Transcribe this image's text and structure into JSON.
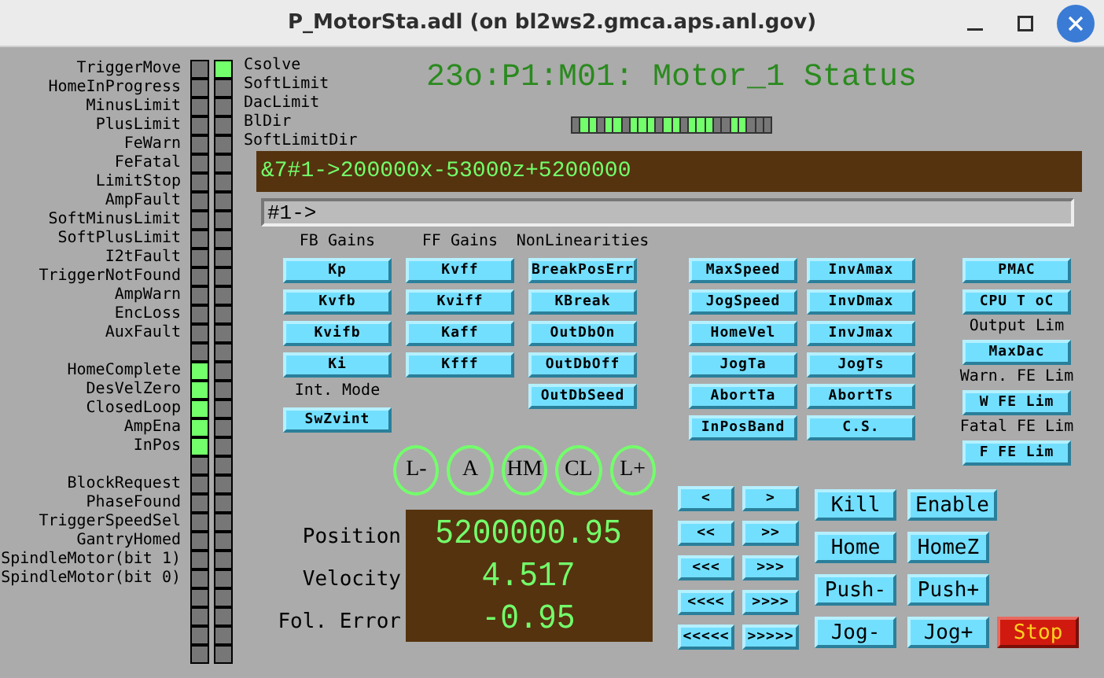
{
  "window": {
    "title": "P_MotorSta.adl (on bl2ws2.gmca.aps.anl.gov)"
  },
  "status_bits_left": [
    {
      "label": "TriggerMove",
      "on": false
    },
    {
      "label": "HomeInProgress",
      "on": false
    },
    {
      "label": "MinusLimit",
      "on": false
    },
    {
      "label": "PlusLimit",
      "on": false
    },
    {
      "label": "FeWarn",
      "on": false
    },
    {
      "label": "FeFatal",
      "on": false
    },
    {
      "label": "LimitStop",
      "on": false
    },
    {
      "label": "AmpFault",
      "on": false
    },
    {
      "label": "SoftMinusLimit",
      "on": false
    },
    {
      "label": "SoftPlusLimit",
      "on": false
    },
    {
      "label": "I2tFault",
      "on": false
    },
    {
      "label": "TriggerNotFound",
      "on": false
    },
    {
      "label": "AmpWarn",
      "on": false
    },
    {
      "label": "EncLoss",
      "on": false
    },
    {
      "label": "AuxFault",
      "on": false
    },
    {
      "on": false
    },
    {
      "label": "HomeComplete",
      "on": true
    },
    {
      "label": "DesVelZero",
      "on": true
    },
    {
      "label": "ClosedLoop",
      "on": true
    },
    {
      "label": "AmpEna",
      "on": true
    },
    {
      "label": "InPos",
      "on": true
    },
    {
      "on": false
    },
    {
      "label": "BlockRequest",
      "on": false
    },
    {
      "label": "PhaseFound",
      "on": false
    },
    {
      "label": "TriggerSpeedSel",
      "on": false
    },
    {
      "label": "GantryHomed",
      "on": false
    },
    {
      "label": "SpindleMotor(bit 1)",
      "on": false
    },
    {
      "label": "SpindleMotor(bit 0)",
      "on": false
    },
    {
      "on": false
    },
    {
      "on": false
    },
    {
      "on": false
    },
    {
      "on": false
    }
  ],
  "status_bits_right": [
    {
      "label": "Csolve",
      "on": true
    },
    {
      "label": "SoftLimit",
      "on": false
    },
    {
      "label": "DacLimit",
      "on": false
    },
    {
      "label": "BlDir",
      "on": false
    },
    {
      "label": "SoftLimitDir",
      "on": false
    },
    {
      "on": false
    },
    {
      "on": false
    },
    {
      "on": false
    },
    {
      "on": false
    },
    {
      "on": false
    },
    {
      "on": false
    },
    {
      "on": false
    },
    {
      "on": false
    },
    {
      "on": false
    },
    {
      "on": false
    },
    {
      "on": false
    },
    {
      "on": false
    },
    {
      "on": false
    },
    {
      "on": false
    },
    {
      "on": false
    },
    {
      "on": false
    },
    {
      "on": false
    },
    {
      "on": false
    },
    {
      "on": false
    },
    {
      "on": false
    },
    {
      "on": false
    },
    {
      "on": false
    },
    {
      "on": false
    },
    {
      "on": false
    },
    {
      "on": false
    },
    {
      "on": false
    },
    {
      "on": false
    }
  ],
  "title": "23o:P1:M01: Motor_1 Status",
  "activity_bits": [
    {
      "on": false
    },
    {
      "on": true
    },
    {
      "on": true
    },
    {
      "on": false
    },
    {
      "on": true
    },
    {
      "on": true
    },
    {
      "on": false
    },
    {
      "on": true
    },
    {
      "on": true
    },
    {
      "on": true
    },
    {
      "on": false
    },
    {
      "on": true
    },
    {
      "on": true
    },
    {
      "on": false
    },
    {
      "on": true
    },
    {
      "on": true
    },
    {
      "on": true
    },
    {
      "on": false
    },
    {
      "on": false
    },
    {
      "on": true
    },
    {
      "on": true
    },
    {
      "on": false
    },
    {
      "on": false
    },
    {
      "on": false
    }
  ],
  "response": "&7#1->200000x-53000z+5200000",
  "command_field": {
    "value": "#1->"
  },
  "gain_groups": [
    {
      "heading": "FB Gains",
      "buttons": [
        "Kp",
        "Kvfb",
        "Kvifb",
        "Ki"
      ],
      "sub_heading": "Int. Mode",
      "sub_buttons": [
        "SwZvint"
      ]
    },
    {
      "heading": "FF Gains",
      "buttons": [
        "Kvff",
        "Kviff",
        "Kaff",
        "Kfff"
      ]
    },
    {
      "heading": "NonLinearities",
      "buttons": [
        "BreakPosErr",
        "KBreak",
        "OutDbOn",
        "OutDbOff",
        "OutDbSeed"
      ]
    }
  ],
  "motion_columns": [
    [
      "MaxSpeed",
      "JogSpeed",
      "HomeVel",
      "JogTa",
      "AbortTa",
      "InPosBand"
    ],
    [
      "InvAmax",
      "InvDmax",
      "InvJmax",
      "JogTs",
      "AbortTs",
      "C.S."
    ]
  ],
  "pmac_items": [
    {
      "kind": "button",
      "text": "PMAC"
    },
    {
      "kind": "button",
      "text": "CPU T oC"
    },
    {
      "kind": "label",
      "text": "Output Lim"
    },
    {
      "kind": "button",
      "text": "MaxDac"
    },
    {
      "kind": "label",
      "text": "Warn. FE Lim"
    },
    {
      "kind": "button",
      "text": "W FE Lim"
    },
    {
      "kind": "label",
      "text": "Fatal FE Lim"
    },
    {
      "kind": "button",
      "text": "F FE Lim"
    }
  ],
  "limit_indicators": [
    "L-",
    "A",
    "HM",
    "CL",
    "L+"
  ],
  "readback": [
    {
      "label": "Position",
      "value": "5200000.95"
    },
    {
      "label": "Velocity",
      "value": "4.517"
    },
    {
      "label": "Fol. Error",
      "value": "-0.95"
    }
  ],
  "jog_rows": [
    {
      "left": "<",
      "right": ">"
    },
    {
      "left": "<<",
      "right": ">>"
    },
    {
      "left": "<<<",
      "right": ">>>"
    },
    {
      "left": "<<<<",
      "right": ">>>>"
    },
    {
      "left": "<<<<<",
      "right": ">>>>>"
    }
  ],
  "action_rows": [
    [
      {
        "kind": "normal",
        "text": "Kill"
      },
      {
        "kind": "normal",
        "text": "Enable"
      }
    ],
    [
      {
        "kind": "normal",
        "text": "Home"
      },
      {
        "kind": "normal",
        "text": "HomeZ"
      }
    ],
    [
      {
        "kind": "normal",
        "text": "Push-"
      },
      {
        "kind": "normal",
        "text": "Push+"
      }
    ],
    [
      {
        "kind": "normal",
        "text": "Jog-"
      },
      {
        "kind": "normal",
        "text": "Jog+"
      },
      {
        "kind": "stop",
        "text": "Stop"
      }
    ]
  ]
}
